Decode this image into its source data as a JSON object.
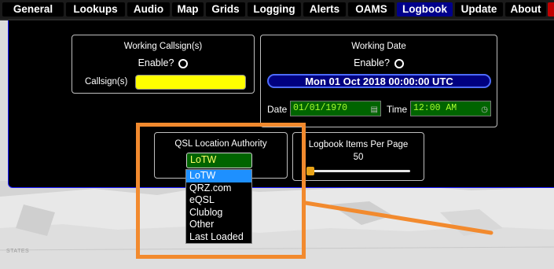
{
  "tabs": [
    {
      "label": "General"
    },
    {
      "label": "Lookups"
    },
    {
      "label": "Audio"
    },
    {
      "label": "Map"
    },
    {
      "label": "Grids"
    },
    {
      "label": "Logging"
    },
    {
      "label": "Alerts"
    },
    {
      "label": "OAMS"
    },
    {
      "label": "Logbook",
      "active": true
    },
    {
      "label": "Update"
    },
    {
      "label": "About"
    }
  ],
  "working_callsign": {
    "title": "Working Callsign(s)",
    "enable_label": "Enable?",
    "callsign_label": "Callsign(s)",
    "callsign_value": ""
  },
  "working_date": {
    "title": "Working Date",
    "enable_label": "Enable?",
    "date_display": "Mon 01 Oct 2018 00:00:00 UTC",
    "date_label": "Date",
    "date_value": "01/01/1970",
    "time_label": "Time",
    "time_value": "12:00 AM"
  },
  "qsl_authority": {
    "title": "QSL Location Authority",
    "selected": "LoTW",
    "options": [
      "LoTW",
      "QRZ.com",
      "eQSL",
      "Clublog",
      "Other",
      "Last Loaded"
    ]
  },
  "logbook_items": {
    "title": "Logbook Items Per Page",
    "value": "50",
    "slider_fraction": 0.0
  },
  "map": {
    "label": "STATES"
  },
  "colors": {
    "active_tab": "#00008b",
    "annotation": "#f28a2e",
    "field_green": "#006400",
    "highlight_yellow": "#ffff00"
  }
}
